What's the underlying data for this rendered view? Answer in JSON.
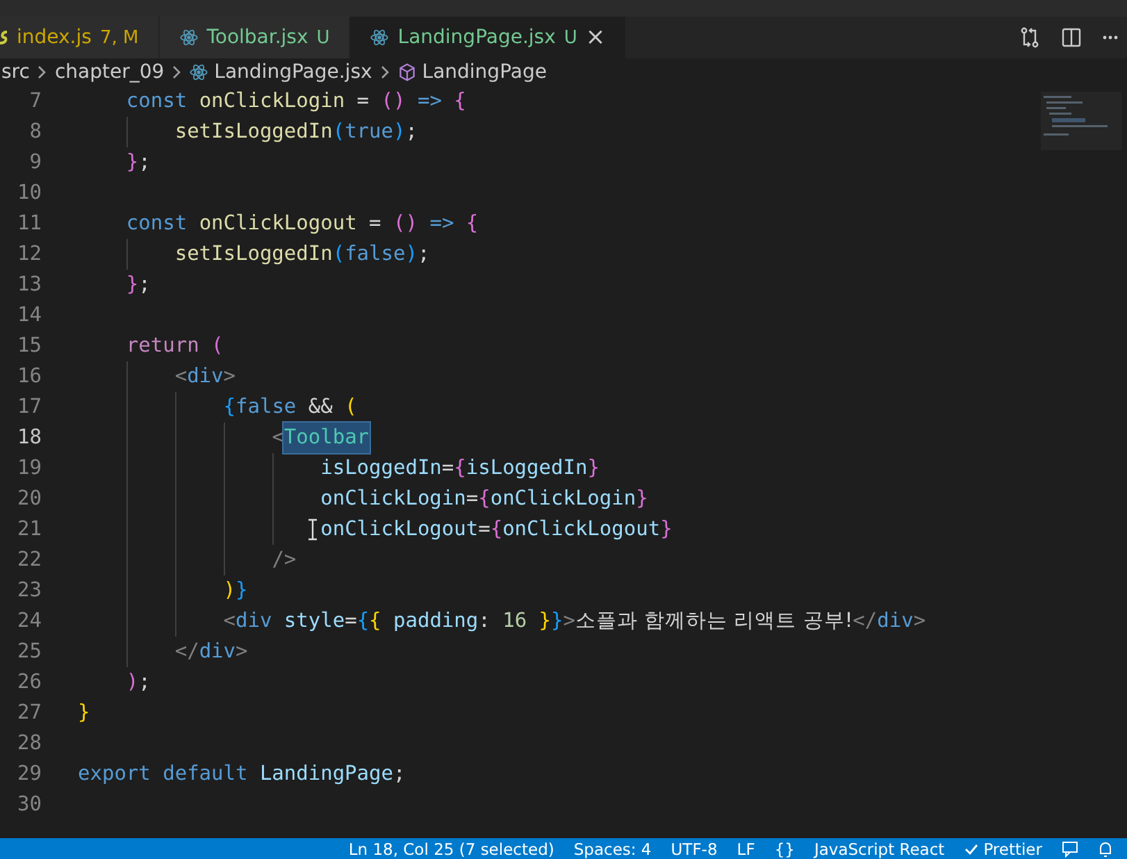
{
  "tabs": [
    {
      "label": "index.js",
      "badge": "7, M",
      "color": "#cca700",
      "kind": "js",
      "selected": false
    },
    {
      "label": "Toolbar.jsx",
      "badge": "U",
      "color": "#73c991",
      "kind": "react",
      "selected": false
    },
    {
      "label": "LandingPage.jsx",
      "badge": "U",
      "color": "#73c991",
      "kind": "react",
      "selected": true,
      "close": "×"
    }
  ],
  "breadcrumbs": [
    {
      "label": "src",
      "kind": "folder"
    },
    {
      "label": "chapter_09",
      "kind": "folder"
    },
    {
      "label": "LandingPage.jsx",
      "kind": "react"
    },
    {
      "label": "LandingPage",
      "kind": "symbol"
    }
  ],
  "editor": {
    "lines": [
      {
        "number": "7",
        "current": false,
        "tokens": [
          {
            "kind": "keyword",
            "text": "    const "
          },
          {
            "kind": "func",
            "text": "onClickLogin"
          },
          {
            "kind": "punct",
            "text": " = "
          },
          {
            "kind": "b2",
            "text": "()"
          },
          {
            "kind": "keyword",
            "text": " => "
          },
          {
            "kind": "b2",
            "text": "{"
          }
        ]
      },
      {
        "number": "8",
        "current": false,
        "tokens": [
          {
            "kind": "func",
            "text": "        setIsLoggedIn"
          },
          {
            "kind": "b3",
            "text": "("
          },
          {
            "kind": "keyword",
            "text": "true"
          },
          {
            "kind": "b3",
            "text": ")"
          },
          {
            "kind": "punct",
            "text": ";"
          }
        ]
      },
      {
        "number": "9",
        "current": false,
        "tokens": [
          {
            "kind": "b2",
            "text": "    }"
          },
          {
            "kind": "punct",
            "text": ";"
          }
        ]
      },
      {
        "number": "10",
        "current": false
      },
      {
        "number": "11",
        "current": false,
        "tokens": [
          {
            "kind": "keyword",
            "text": "    const "
          },
          {
            "kind": "func",
            "text": "onClickLogout"
          },
          {
            "kind": "punct",
            "text": " = "
          },
          {
            "kind": "b2",
            "text": "()"
          },
          {
            "kind": "keyword",
            "text": " => "
          },
          {
            "kind": "b2",
            "text": "{"
          }
        ]
      },
      {
        "number": "12",
        "current": false,
        "tokens": [
          {
            "kind": "func",
            "text": "        setIsLoggedIn"
          },
          {
            "kind": "b3",
            "text": "("
          },
          {
            "kind": "keyword",
            "text": "false"
          },
          {
            "kind": "b3",
            "text": ")"
          },
          {
            "kind": "punct",
            "text": ";"
          }
        ]
      },
      {
        "number": "13",
        "current": false,
        "tokens": [
          {
            "kind": "b2",
            "text": "    }"
          },
          {
            "kind": "punct",
            "text": ";"
          }
        ]
      },
      {
        "number": "14",
        "current": false
      },
      {
        "number": "15",
        "current": false,
        "tokens": [
          {
            "kind": "control",
            "text": "    return "
          },
          {
            "kind": "b2",
            "text": "("
          }
        ]
      },
      {
        "number": "16",
        "current": false,
        "tokens": [
          {
            "kind": "angle",
            "text": "        <"
          },
          {
            "kind": "tag",
            "text": "div"
          },
          {
            "kind": "angle",
            "text": ">"
          }
        ]
      },
      {
        "number": "17",
        "current": false,
        "tokens": [
          {
            "kind": "b3",
            "text": "            {"
          },
          {
            "kind": "keyword",
            "text": "false"
          },
          {
            "kind": "punct",
            "text": " && "
          },
          {
            "kind": "b1",
            "text": "("
          }
        ]
      },
      {
        "number": "18",
        "current": true,
        "tokens": [
          {
            "kind": "angle",
            "text": "                <"
          },
          {
            "kind": "selected-component",
            "text": "Toolbar"
          }
        ]
      },
      {
        "number": "19",
        "current": false,
        "tokens": [
          {
            "kind": "attr",
            "text": "                    isLoggedIn"
          },
          {
            "kind": "punct",
            "text": "="
          },
          {
            "kind": "b2",
            "text": "{"
          },
          {
            "kind": "var",
            "text": "isLoggedIn"
          },
          {
            "kind": "b2",
            "text": "}"
          }
        ]
      },
      {
        "number": "20",
        "current": false,
        "tokens": [
          {
            "kind": "attr",
            "text": "                    onClickLogin"
          },
          {
            "kind": "punct",
            "text": "="
          },
          {
            "kind": "b2",
            "text": "{"
          },
          {
            "kind": "var",
            "text": "onClickLogin"
          },
          {
            "kind": "b2",
            "text": "}"
          }
        ]
      },
      {
        "number": "21",
        "current": false,
        "tokens": [
          {
            "kind": "attr",
            "text": "                    onClickLogout"
          },
          {
            "kind": "punct",
            "text": "="
          },
          {
            "kind": "b2",
            "text": "{"
          },
          {
            "kind": "var",
            "text": "onClickLogout"
          },
          {
            "kind": "b2",
            "text": "}"
          }
        ]
      },
      {
        "number": "22",
        "current": false,
        "tokens": [
          {
            "kind": "angle",
            "text": "                />"
          }
        ]
      },
      {
        "number": "23",
        "current": false,
        "tokens": [
          {
            "kind": "b1",
            "text": "            )"
          },
          {
            "kind": "b3",
            "text": "}"
          }
        ]
      },
      {
        "number": "24",
        "current": false,
        "tokens": [
          {
            "kind": "angle",
            "text": "            <"
          },
          {
            "kind": "tag",
            "text": "div "
          },
          {
            "kind": "attr",
            "text": "style"
          },
          {
            "kind": "punct",
            "text": "="
          },
          {
            "kind": "b3",
            "text": "{"
          },
          {
            "kind": "b1",
            "text": "{ "
          },
          {
            "kind": "attr",
            "text": "padding"
          },
          {
            "kind": "punct",
            "text": ": "
          },
          {
            "kind": "number",
            "text": "16"
          },
          {
            "kind": "b1",
            "text": " }"
          },
          {
            "kind": "b3",
            "text": "}"
          },
          {
            "kind": "angle",
            "text": ">"
          },
          {
            "kind": "text",
            "text": "소플과 함께하는 리액트 공부!"
          },
          {
            "kind": "angle",
            "text": "</"
          },
          {
            "kind": "tag",
            "text": "div"
          },
          {
            "kind": "angle",
            "text": ">"
          }
        ]
      },
      {
        "number": "25",
        "current": false,
        "tokens": [
          {
            "kind": "angle",
            "text": "        </"
          },
          {
            "kind": "tag",
            "text": "div"
          },
          {
            "kind": "angle",
            "text": ">"
          }
        ]
      },
      {
        "number": "26",
        "current": false,
        "tokens": [
          {
            "kind": "b2",
            "text": "    )"
          },
          {
            "kind": "punct",
            "text": ";"
          }
        ]
      },
      {
        "number": "27",
        "current": false,
        "tokens": [
          {
            "kind": "b1",
            "text": "}"
          }
        ]
      },
      {
        "number": "28",
        "current": false
      },
      {
        "number": "29",
        "current": false,
        "tokens": [
          {
            "kind": "keyword",
            "text": "export default "
          },
          {
            "kind": "var",
            "text": "LandingPage"
          },
          {
            "kind": "punct",
            "text": ";"
          }
        ]
      },
      {
        "number": "30",
        "current": false
      }
    ]
  },
  "status_bar": [
    {
      "text": "Ln 18, Col 25 (7 selected)",
      "kind": "text"
    },
    {
      "text": "Spaces: 4",
      "kind": "text"
    },
    {
      "text": "UTF-8",
      "kind": "text"
    },
    {
      "text": "LF",
      "kind": "text"
    },
    {
      "text": "{}",
      "kind": "text"
    },
    {
      "text": "JavaScript React",
      "kind": "text"
    },
    {
      "text": "Prettier",
      "kind": "check"
    }
  ]
}
